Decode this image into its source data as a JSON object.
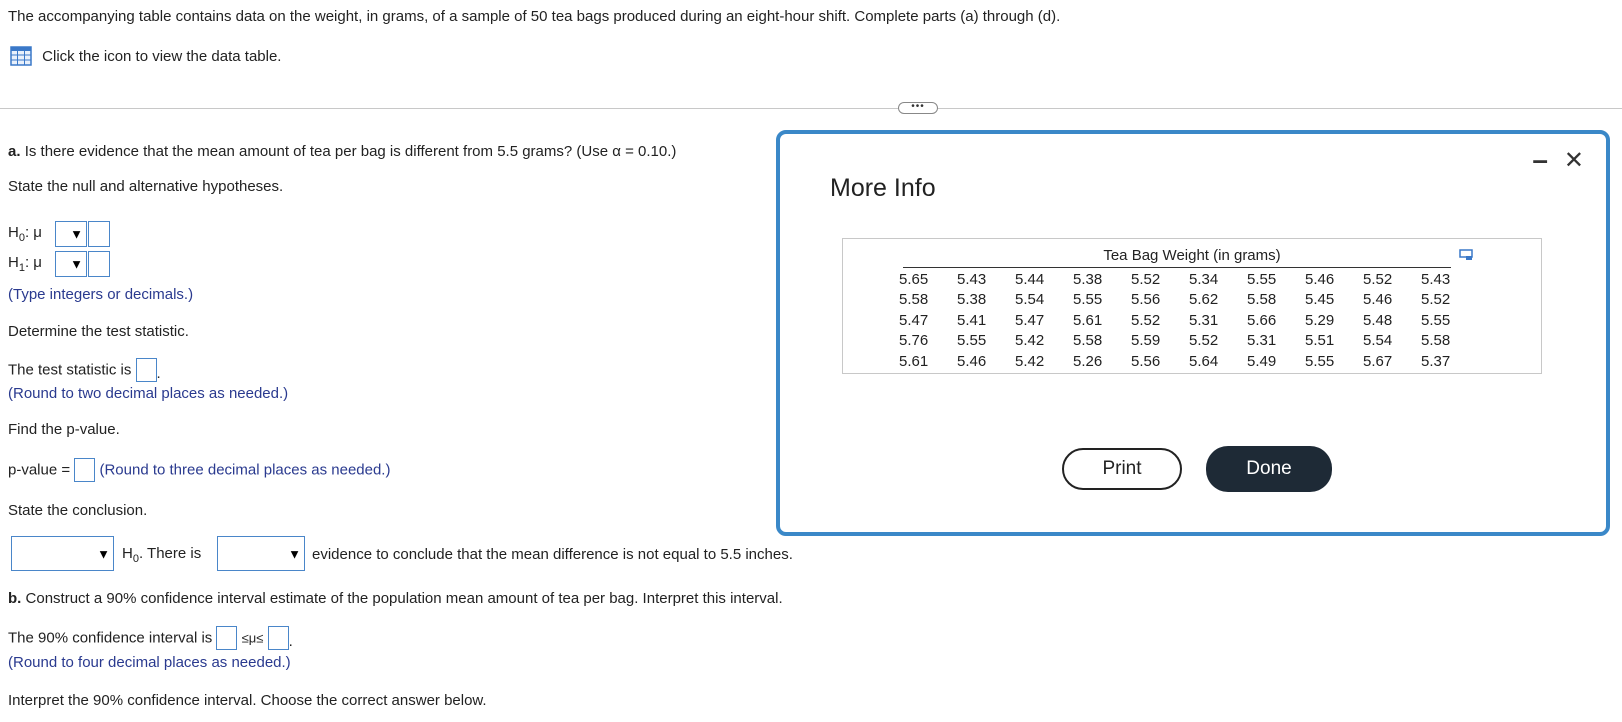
{
  "intro": "The accompanying table contains data on the weight, in grams, of a sample of 50 tea bags produced during an eight-hour shift. Complete parts (a) through (d).",
  "data_link": "Click the icon to view the data table.",
  "expand_dots": "•••",
  "part_a": {
    "label": "a.",
    "question_pre": "Is there evidence that the mean amount of tea per bag is different from 5.5 grams? (Use ",
    "alpha_text": "α = 0.10.)",
    "state_hyp": "State the null and alternative hypotheses.",
    "h0_symbol": "H",
    "h0_sub": "0",
    "h1_symbol": "H",
    "h1_sub": "1",
    "mu": ": μ",
    "type_hint": "(Type integers or decimals.)",
    "determine_stat": "Determine the test statistic.",
    "stat_label": "The test statistic is",
    "stat_round": "(Round to two decimal places as needed.)",
    "find_p": "Find the p-value.",
    "p_label": "p-value =",
    "p_round": "(Round to three decimal places as needed.)",
    "state_conclusion": "State the conclusion.",
    "conclusion_h0": "H",
    "conclusion_h0_sub": "0",
    "conclusion_mid": ". There is",
    "conclusion_end": "evidence to conclude that the mean difference is not equal to 5.5 inches."
  },
  "part_b": {
    "label": "b.",
    "question": "Construct a 90% confidence interval estimate of the population mean amount of tea per bag. Interpret this interval.",
    "ci_label": "The 90% confidence interval is",
    "ci_mid": "≤μ≤",
    "ci_round": "(Round to four decimal places as needed.)",
    "interpret": "Interpret the 90% confidence interval. Choose the correct answer below."
  },
  "dropdown_arrow": "▼",
  "modal": {
    "title": "More Info",
    "minimize": "–",
    "close": "✕",
    "table_title": "Tea Bag Weight (in grams)",
    "rows": [
      [
        "5.65",
        "5.43",
        "5.44",
        "5.38",
        "5.52",
        "5.34",
        "5.55",
        "5.46",
        "5.52",
        "5.43"
      ],
      [
        "5.58",
        "5.38",
        "5.54",
        "5.55",
        "5.56",
        "5.62",
        "5.58",
        "5.45",
        "5.46",
        "5.52"
      ],
      [
        "5.47",
        "5.41",
        "5.47",
        "5.61",
        "5.52",
        "5.31",
        "5.66",
        "5.29",
        "5.48",
        "5.55"
      ],
      [
        "5.76",
        "5.55",
        "5.42",
        "5.58",
        "5.59",
        "5.52",
        "5.31",
        "5.51",
        "5.54",
        "5.58"
      ],
      [
        "5.61",
        "5.46",
        "5.42",
        "5.26",
        "5.56",
        "5.64",
        "5.49",
        "5.55",
        "5.67",
        "5.37"
      ]
    ],
    "print_label": "Print",
    "done_label": "Done"
  },
  "colors": {
    "accent_blue": "#4a86c9",
    "modal_border": "#3a88c8",
    "hint_text": "#2a3a8f",
    "done_bg": "#1e2a36"
  }
}
